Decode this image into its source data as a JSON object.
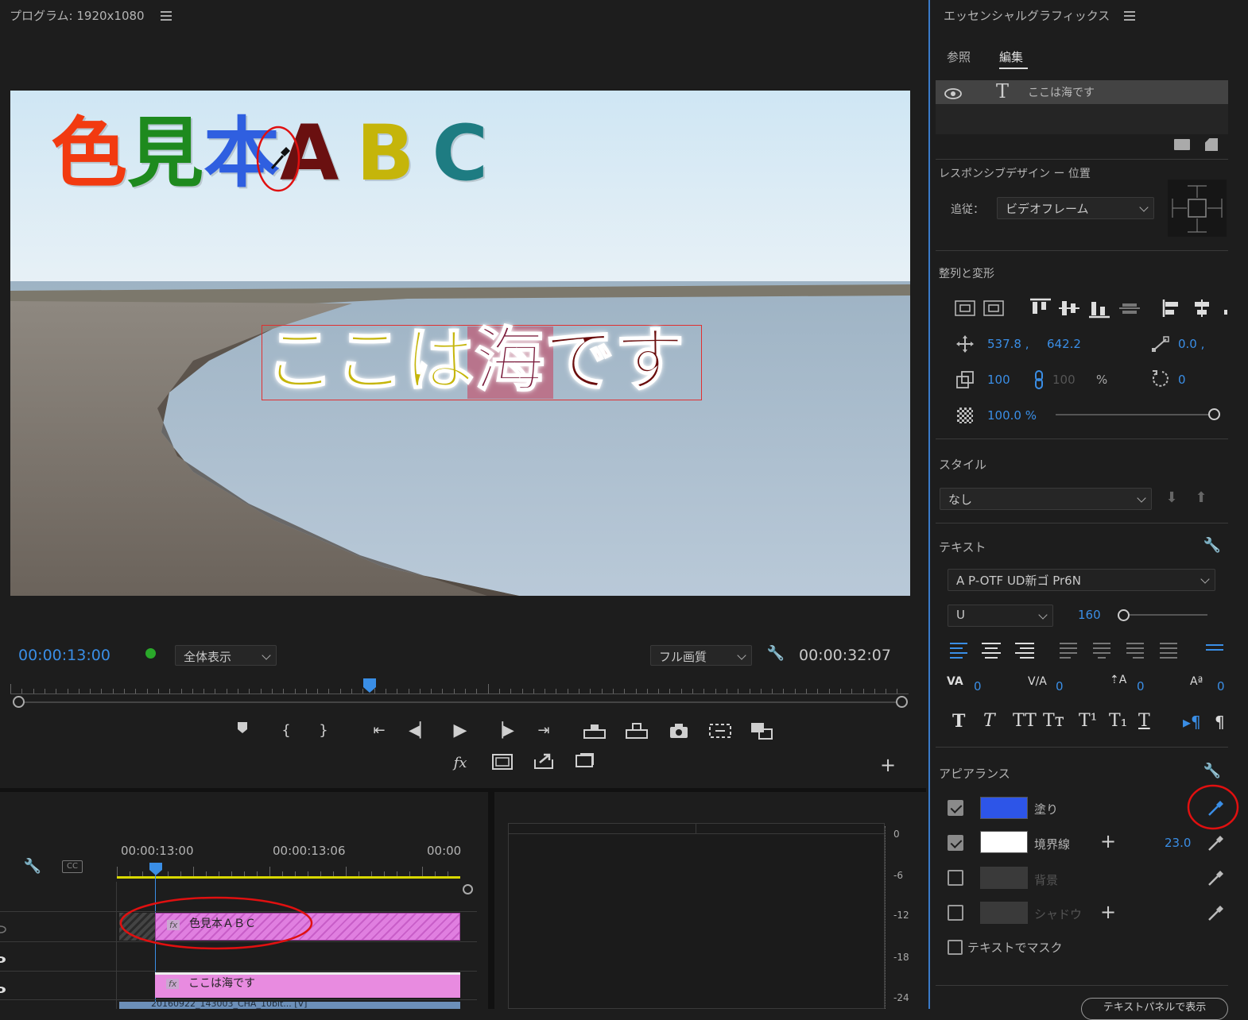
{
  "program_monitor": {
    "title": "プログラム: 1920x1080",
    "overlay_title_chars": [
      {
        "ch": "色",
        "color": "#f23a10"
      },
      {
        "ch": "見",
        "color": "#1e8a1e"
      },
      {
        "ch": "本",
        "color": "#2f5fe0"
      },
      {
        "ch": "A",
        "color": "#6a1010"
      },
      {
        "ch": "B",
        "color": "#c5b50a"
      },
      {
        "ch": "C",
        "color": "#1e7c82"
      }
    ],
    "overlay_caption_chars": [
      {
        "ch": "こ",
        "color": "#c5b50a"
      },
      {
        "ch": "こ",
        "color": "#c5b50a"
      },
      {
        "ch": "は",
        "color": "#c5b50a"
      },
      {
        "ch": "海",
        "color": "#7a1a3a"
      },
      {
        "ch": "で",
        "color": "#6a0c0c"
      },
      {
        "ch": "す",
        "color": "#6a0c0c"
      }
    ],
    "timecode_current": "00:00:13:00",
    "zoom_select": "全体表示",
    "quality_select": "フル画質",
    "timecode_duration": "00:00:32:07"
  },
  "timeline": {
    "ruler_labels": [
      "00:00:13:00",
      "00:00:13:06",
      "00:00"
    ],
    "clips": [
      {
        "label": "色見本ＡＢＣ",
        "fx": "fx"
      },
      {
        "label": "ここは海です",
        "fx": "fx"
      }
    ],
    "bottom_clip_label": "20160922_143003_CHA_10bit... [V]"
  },
  "audio_meter": {
    "scale": [
      "0",
      "-6",
      "-12",
      "-18",
      "-24"
    ]
  },
  "essential_graphics": {
    "title": "エッセンシャルグラフィックス",
    "tabs": [
      "参照",
      "編集"
    ],
    "active_tab": "編集",
    "layer_name": "ここは海です",
    "responsive_heading": "レスポンシブデザイン ー 位置",
    "follow_label": "追従：",
    "follow_value": "ビデオフレーム",
    "align_heading": "整列と変形",
    "pos_x": "537.8 ,",
    "pos_y": "642.2",
    "anchor_x": "0.0 ,",
    "scale_value": "100",
    "scale_linked": "100",
    "percent": "%",
    "rotation": "0",
    "opacity": "100.0 %",
    "opacity_level": 1.0,
    "style_heading": "スタイル",
    "style_value": "なし",
    "text_heading": "テキスト",
    "font_family": "A P-OTF UD新ゴ Pr6N",
    "font_style": "U",
    "font_size": "160",
    "kerning": "0",
    "tracking": "0",
    "leading": "0",
    "baseline": "0",
    "appearance_heading": "アピアランス",
    "fill_label": "塗り",
    "fill_color": "#2d55e8",
    "stroke_label": "境界線",
    "stroke_color": "#ffffff",
    "stroke_width": "23.0",
    "background_label": "背景",
    "shadow_label": "シャドウ",
    "mask_label": "テキストでマスク",
    "bottom_button": "テキストパネルで表示"
  }
}
